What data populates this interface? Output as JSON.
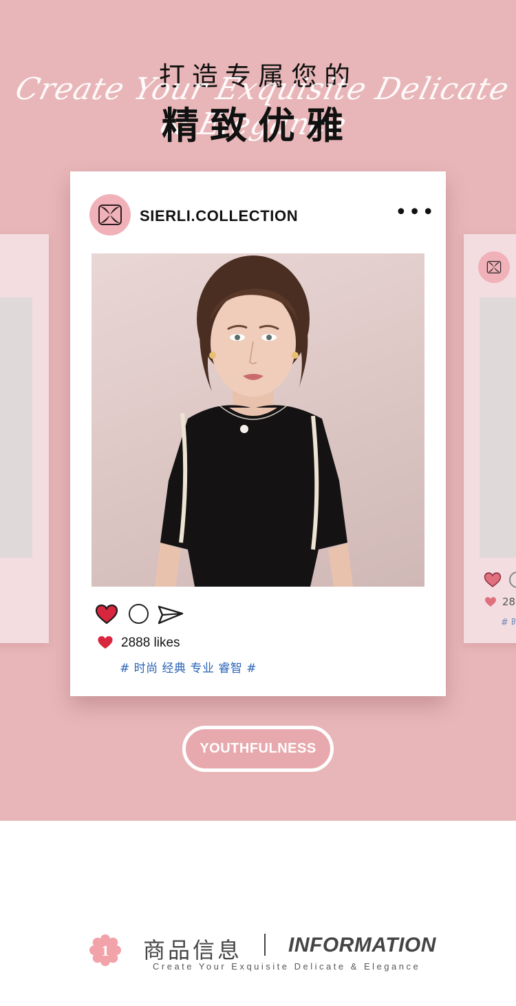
{
  "header": {
    "title_line1": "打造专属您的",
    "script_text": "Create Your Exquisite Delicate & Elegance",
    "title_line2": "精致优雅"
  },
  "post": {
    "username": "SIERLI.COLLECTION",
    "more_label": "•••",
    "likes": "2888 likes",
    "tags": "# 时尚 经典 专业 睿智 #",
    "photo_description_icon": "model-photo"
  },
  "side_post": {
    "likes": "28",
    "tags": "# 时"
  },
  "badge": {
    "label": "YOUTHFULNESS"
  },
  "section": {
    "number": "1",
    "title_cn": "商品信息",
    "title_en": "INFORMATION",
    "subtitle": "Create Your Exquisite Delicate & Elegance"
  },
  "colors": {
    "hero_bg": "#e8b6b8",
    "heart": "#d8263e",
    "tag_blue": "#2a63b6",
    "accent_pink": "#f0b2b8"
  }
}
